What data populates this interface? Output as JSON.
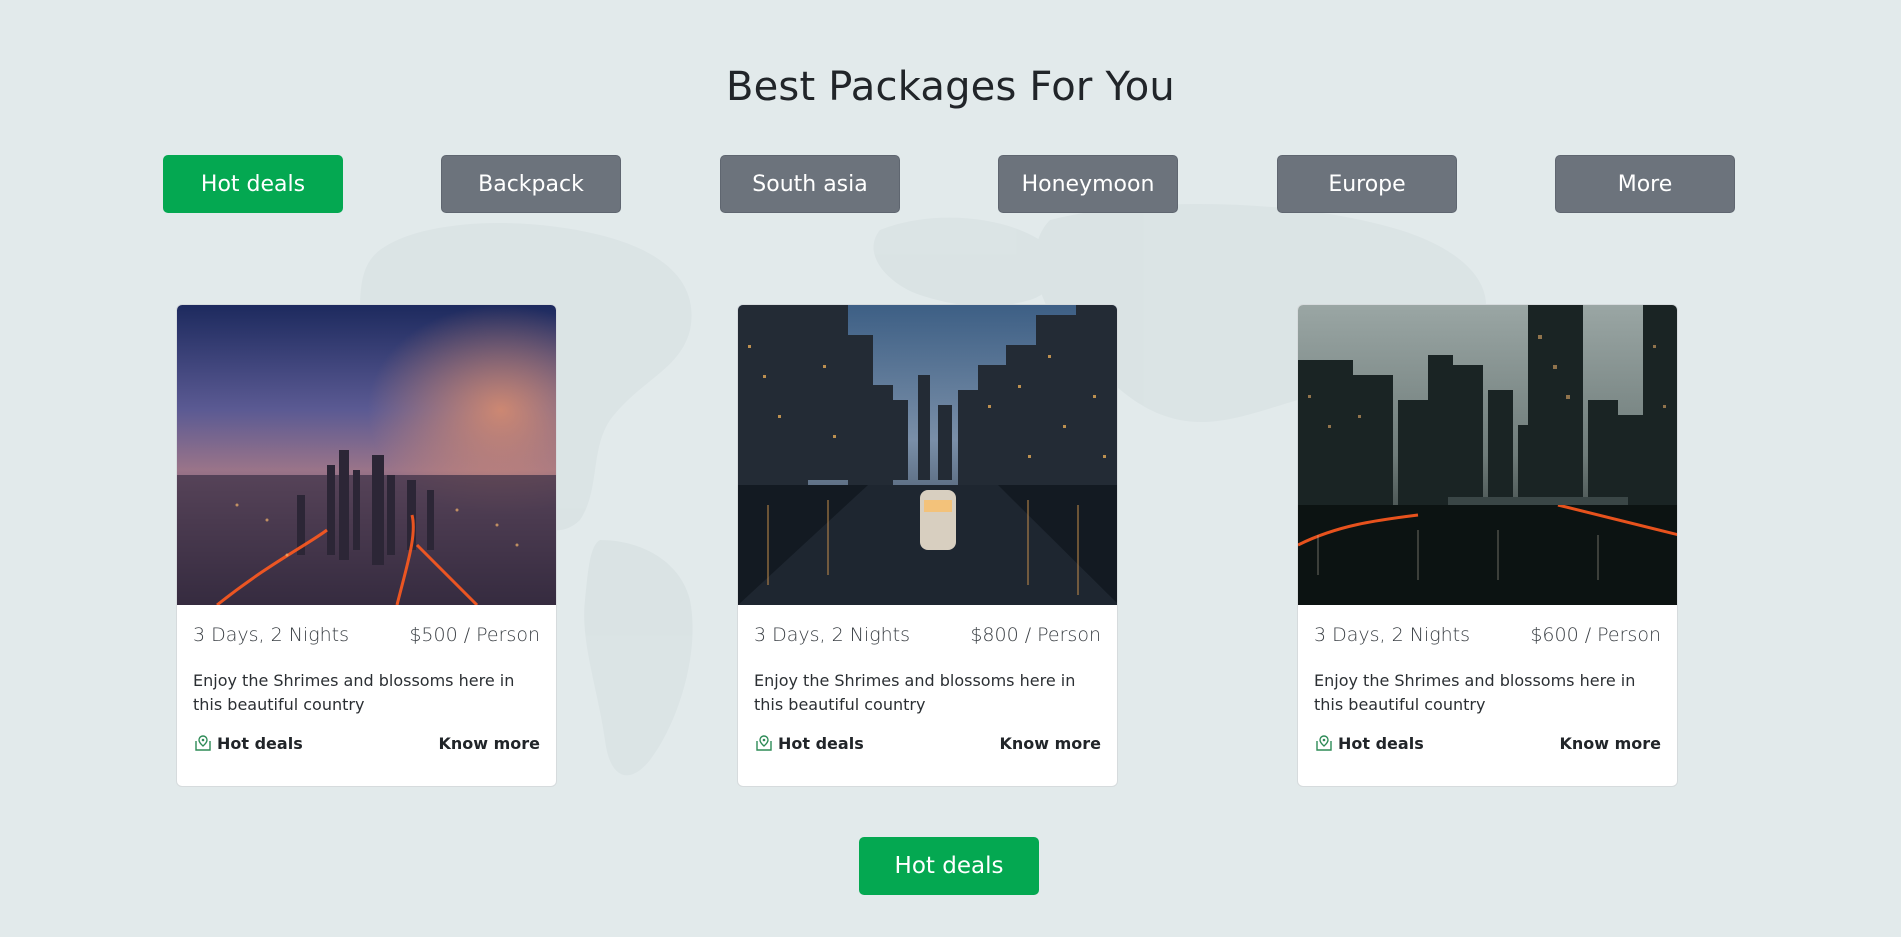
{
  "section": {
    "title": "Best Packages For You"
  },
  "tabs": [
    {
      "label": "Hot deals",
      "active": true
    },
    {
      "label": "Backpack",
      "active": false
    },
    {
      "label": "South asia",
      "active": false
    },
    {
      "label": "Honeymoon",
      "active": false
    },
    {
      "label": "Europe",
      "active": false
    },
    {
      "label": "More",
      "active": false
    }
  ],
  "cards": [
    {
      "duration": "3 Days, 2 Nights",
      "price": "$500 / Person",
      "description": "Enjoy the Shrimes and blossoms here in this beautiful country",
      "tag": "Hot deals",
      "link": "Know more",
      "image": "city-aerial-sunset-photo"
    },
    {
      "duration": "3 Days, 2 Nights",
      "price": "$800 / Person",
      "description": "Enjoy the Shrimes and blossoms here in this beautiful country",
      "tag": "Hot deals",
      "link": "Know more",
      "image": "city-river-boat-night-photo"
    },
    {
      "duration": "3 Days, 2 Nights",
      "price": "$600 / Person",
      "description": "Enjoy the Shrimes and blossoms here in this beautiful country",
      "tag": "Hot deals",
      "link": "Know more",
      "image": "city-skyline-river-dusk-photo"
    }
  ],
  "bottom_button": {
    "label": "Hot deals"
  },
  "icons": {
    "tag_icon": "location-tag-icon"
  },
  "colors": {
    "background": "#e2eaeb",
    "accent_green": "#04a851",
    "tab_gray": "#6c737c",
    "card_bg": "#ffffff"
  }
}
